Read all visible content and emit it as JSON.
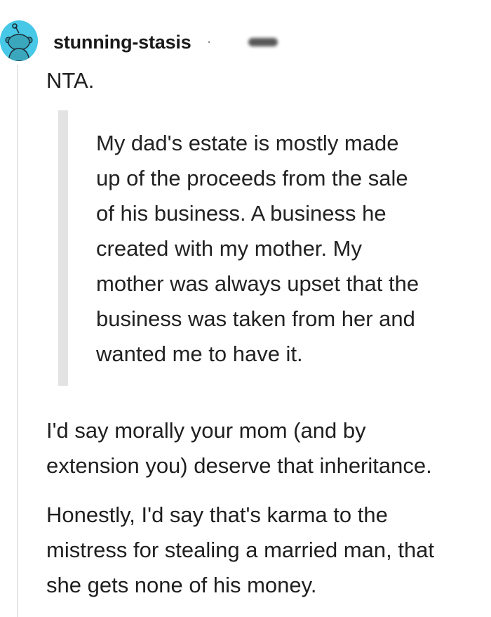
{
  "comment": {
    "username": "stunning-stasis",
    "separator": "·",
    "body": {
      "opening": "NTA.",
      "quote_lines": [
        "My dad's estate is mostly made",
        "up of the proceeds from the sale",
        "of his business. A business he",
        "created with my mother. My",
        "mother was always upset that the",
        "business was taken from her and",
        "wanted me to have it."
      ],
      "paragraph_2_lines": [
        "I'd say morally your mom (and by",
        "extension you) deserve that inheritance."
      ],
      "paragraph_3_lines": [
        "Honestly, I'd say that's karma to the",
        "mistress for stealing a married man, that",
        "she gets none of his money."
      ]
    }
  },
  "colors": {
    "avatar_bg": "#46c8e6",
    "thread_line": "#e6e6e6",
    "quote_bar": "#e3e3e3"
  },
  "icons": {
    "avatar": "reddit-snoo-avatar-icon"
  }
}
